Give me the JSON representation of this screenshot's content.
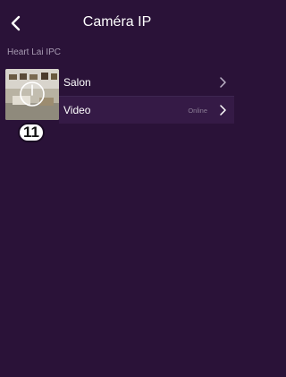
{
  "header": {
    "title": "Caméra IP",
    "back_icon": "chevron-left-icon"
  },
  "group": {
    "label": "Heart Lai IPC"
  },
  "camera": {
    "badge": "11",
    "thumbnail": "camera-preview-image",
    "overlay_icon": "power-icon",
    "items": [
      {
        "label": "Salon",
        "status": "",
        "icon": "chevron-right-icon"
      },
      {
        "label": "Video",
        "status": "Online",
        "icon": "chevron-right-icon"
      }
    ]
  },
  "colors": {
    "background": "#2a1238",
    "row_highlight": "#351a46",
    "divider": "#3e2650",
    "muted_text": "#a79ab2"
  }
}
